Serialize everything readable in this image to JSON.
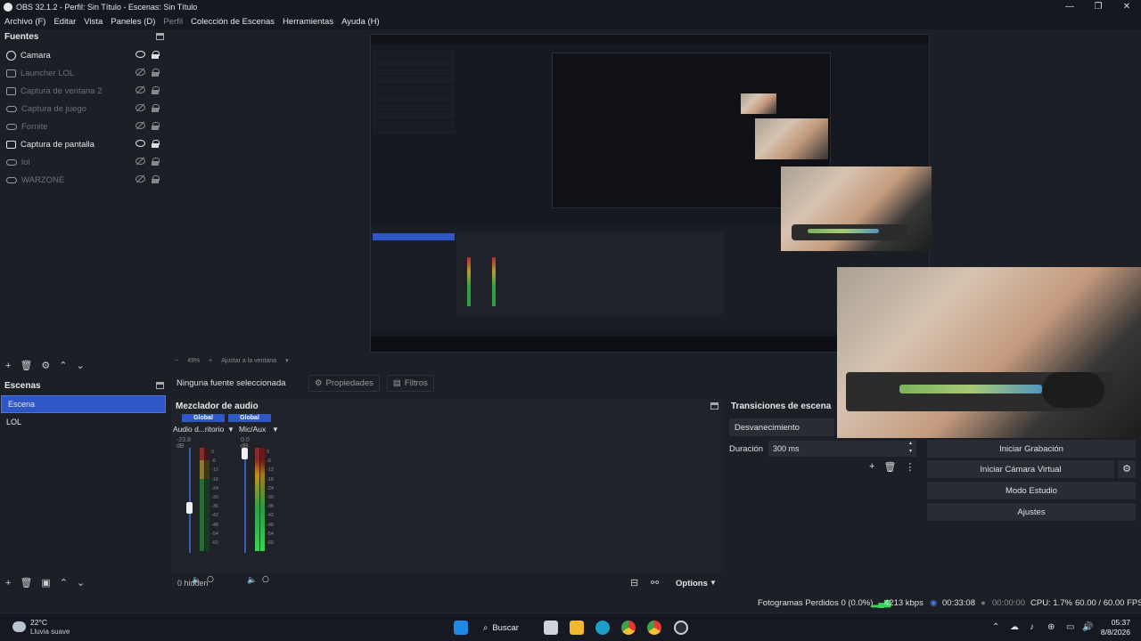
{
  "window": {
    "title": "OBS 32.1.2 - Perfil: Sin Título - Escenas: Sin Título",
    "controls": [
      "—",
      "❐",
      "✕"
    ]
  },
  "menu": [
    "Archivo (F)",
    "Editar",
    "Vista",
    "Paneles (D)",
    "Perfil",
    "Colección de Escenas",
    "Herramientas",
    "Ayuda (H)"
  ],
  "sources": {
    "title": "Fuentes",
    "items": [
      {
        "label": "Camara",
        "icon": "camera-icon",
        "visible": true
      },
      {
        "label": "Launcher LOL",
        "icon": "window-icon",
        "visible": false
      },
      {
        "label": "Captura de ventana 2",
        "icon": "window-icon",
        "visible": false
      },
      {
        "label": "Captura de juego",
        "icon": "gamepad-icon",
        "visible": false
      },
      {
        "label": "Fornite",
        "icon": "gamepad-icon",
        "visible": false
      },
      {
        "label": "Captura de pantalla",
        "icon": "monitor-icon",
        "visible": true
      },
      {
        "label": "lol",
        "icon": "gamepad-icon",
        "visible": false
      },
      {
        "label": "WARZONE",
        "icon": "gamepad-icon",
        "visible": false
      }
    ]
  },
  "scenes": {
    "title": "Escenas",
    "items": [
      {
        "label": "Escena",
        "selected": true
      },
      {
        "label": "LOL",
        "selected": false
      }
    ]
  },
  "preview": {
    "zoom": "49%",
    "fit": "Ajustar a la ventana"
  },
  "properties_bar": {
    "no_source": "Ninguna fuente seleccionada",
    "properties": "Propiedades",
    "filters": "Filtros"
  },
  "mixer": {
    "title": "Mezclador de audio",
    "channels": [
      {
        "badge": "Global",
        "name": "Audio d...ritorio",
        "db": "-23.8 dB",
        "volume_fraction": 0.42
      },
      {
        "badge": "Global",
        "name": "Mic/Aux",
        "db": "0.0 dB",
        "volume_fraction": 1.0
      }
    ],
    "scale": [
      "0",
      "-6",
      "-12",
      "-18",
      "-24",
      "-30",
      "-36",
      "-42",
      "-48",
      "-54",
      "-60"
    ],
    "hidden": "0 hidden",
    "options": "Options"
  },
  "transitions": {
    "title": "Transiciones de escena",
    "selected": "Desvanecimiento",
    "duration_label": "Duración",
    "duration": "300 ms"
  },
  "controls": {
    "buttons": [
      "Iniciar Grabación",
      "Iniciar Cámara Virtual",
      "Modo Estudio",
      "Ajustes"
    ]
  },
  "status": {
    "dropped": "Fotogramas Perdidos 0 (0.0%)",
    "bitrate": "4213 kbps",
    "stream_time": "00:33:08",
    "rec_time": "00:00:00",
    "cpu": "CPU: 1.7%",
    "fps": "60.00 / 60.00 FPS"
  },
  "taskbar": {
    "temp": "22°C",
    "weather": "Lluvia suave",
    "search": "Buscar",
    "time": "05:37",
    "date": "8/8/2026"
  },
  "colors": {
    "accent": "#2f56c6",
    "bg": "#1d1f26",
    "panel": "#20222a"
  }
}
